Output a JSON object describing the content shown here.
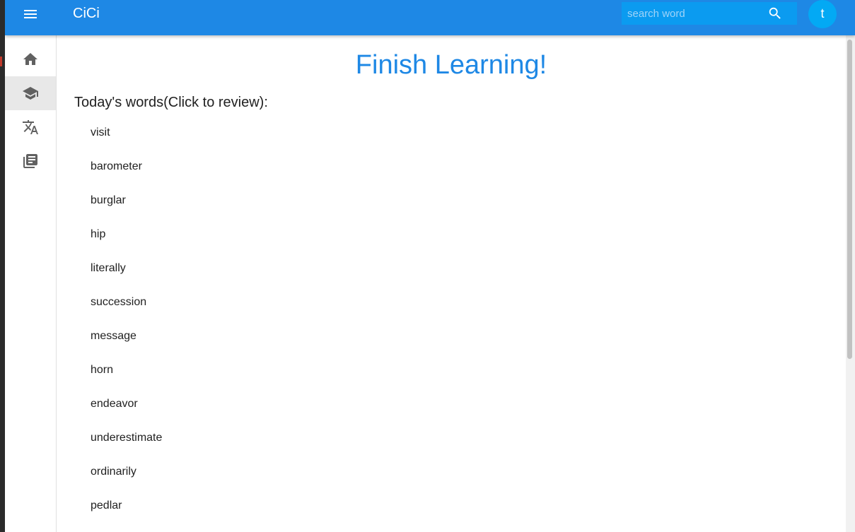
{
  "appbar": {
    "title": "CiCi",
    "search": {
      "placeholder": "search word",
      "value": ""
    },
    "avatar_letter": "t",
    "bg_color": "#1e88e5"
  },
  "sidebar": {
    "items": [
      {
        "icon": "home-icon",
        "active": false
      },
      {
        "icon": "school-icon",
        "active": true
      },
      {
        "icon": "translate-icon",
        "active": false
      },
      {
        "icon": "library-books-icon",
        "active": false
      }
    ]
  },
  "main": {
    "title": "Finish Learning!",
    "subtitle": "Today's words(Click to review):",
    "words": [
      "visit",
      "barometer",
      "burglar",
      "hip",
      "literally",
      "succession",
      "message",
      "horn",
      "endeavor",
      "underestimate",
      "ordinarily",
      "pedlar"
    ],
    "accent_color": "#1e88e5"
  }
}
